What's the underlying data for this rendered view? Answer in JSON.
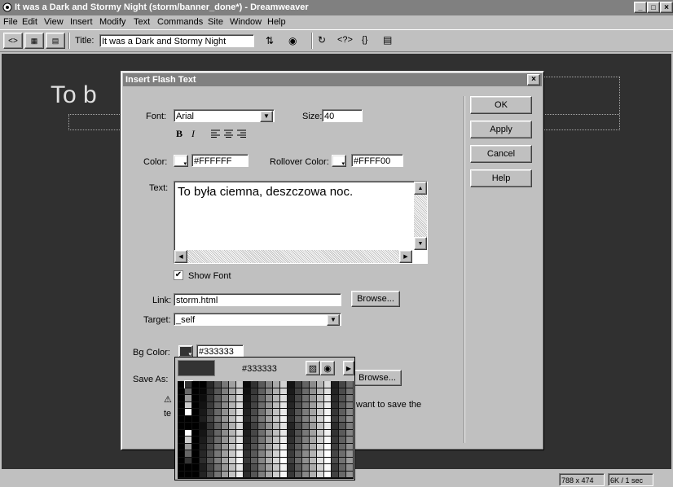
{
  "window": {
    "title": "It was a Dark and Stormy Night (storm/banner_done*) - Dreamweaver",
    "controls": [
      "_",
      "□",
      "×"
    ]
  },
  "menu": [
    "File",
    "Edit",
    "View",
    "Insert",
    "Modify",
    "Text",
    "Commands",
    "Site",
    "Window",
    "Help"
  ],
  "toolbar": {
    "title_label": "Title:",
    "title_value": "It was a Dark and Stormy Night"
  },
  "document": {
    "heading_text": "To b"
  },
  "dialog": {
    "title": "Insert Flash Text",
    "font_label": "Font:",
    "font_value": "Arial",
    "size_label": "Size:",
    "size_value": "40",
    "bold_label": "B",
    "italic_label": "I",
    "color_label": "Color:",
    "color_value": "#FFFFFF",
    "rollover_label": "Rollover Color:",
    "rollover_value": "#FFFF00",
    "text_label": "Text:",
    "text_value": "To była ciemna, deszczowa noc.",
    "show_font_label": "Show Font",
    "show_font_checked": true,
    "link_label": "Link:",
    "link_value": "storm.html",
    "browse_label": "Browse...",
    "target_label": "Target:",
    "target_value": "_self",
    "bg_label": "Bg Color:",
    "bg_value": "#333333",
    "save_label": "Save As:",
    "save_browse_label": "Browse...",
    "note_partial": "want to save the",
    "note_partial2": "te",
    "buttons": {
      "ok": "OK",
      "apply": "Apply",
      "cancel": "Cancel",
      "help": "Help"
    }
  },
  "color_picker": {
    "hex": "#333333",
    "colors": {
      "selected": "#333333"
    }
  },
  "status": {
    "size": "788 x 474",
    "download": "6K / 1 sec"
  }
}
